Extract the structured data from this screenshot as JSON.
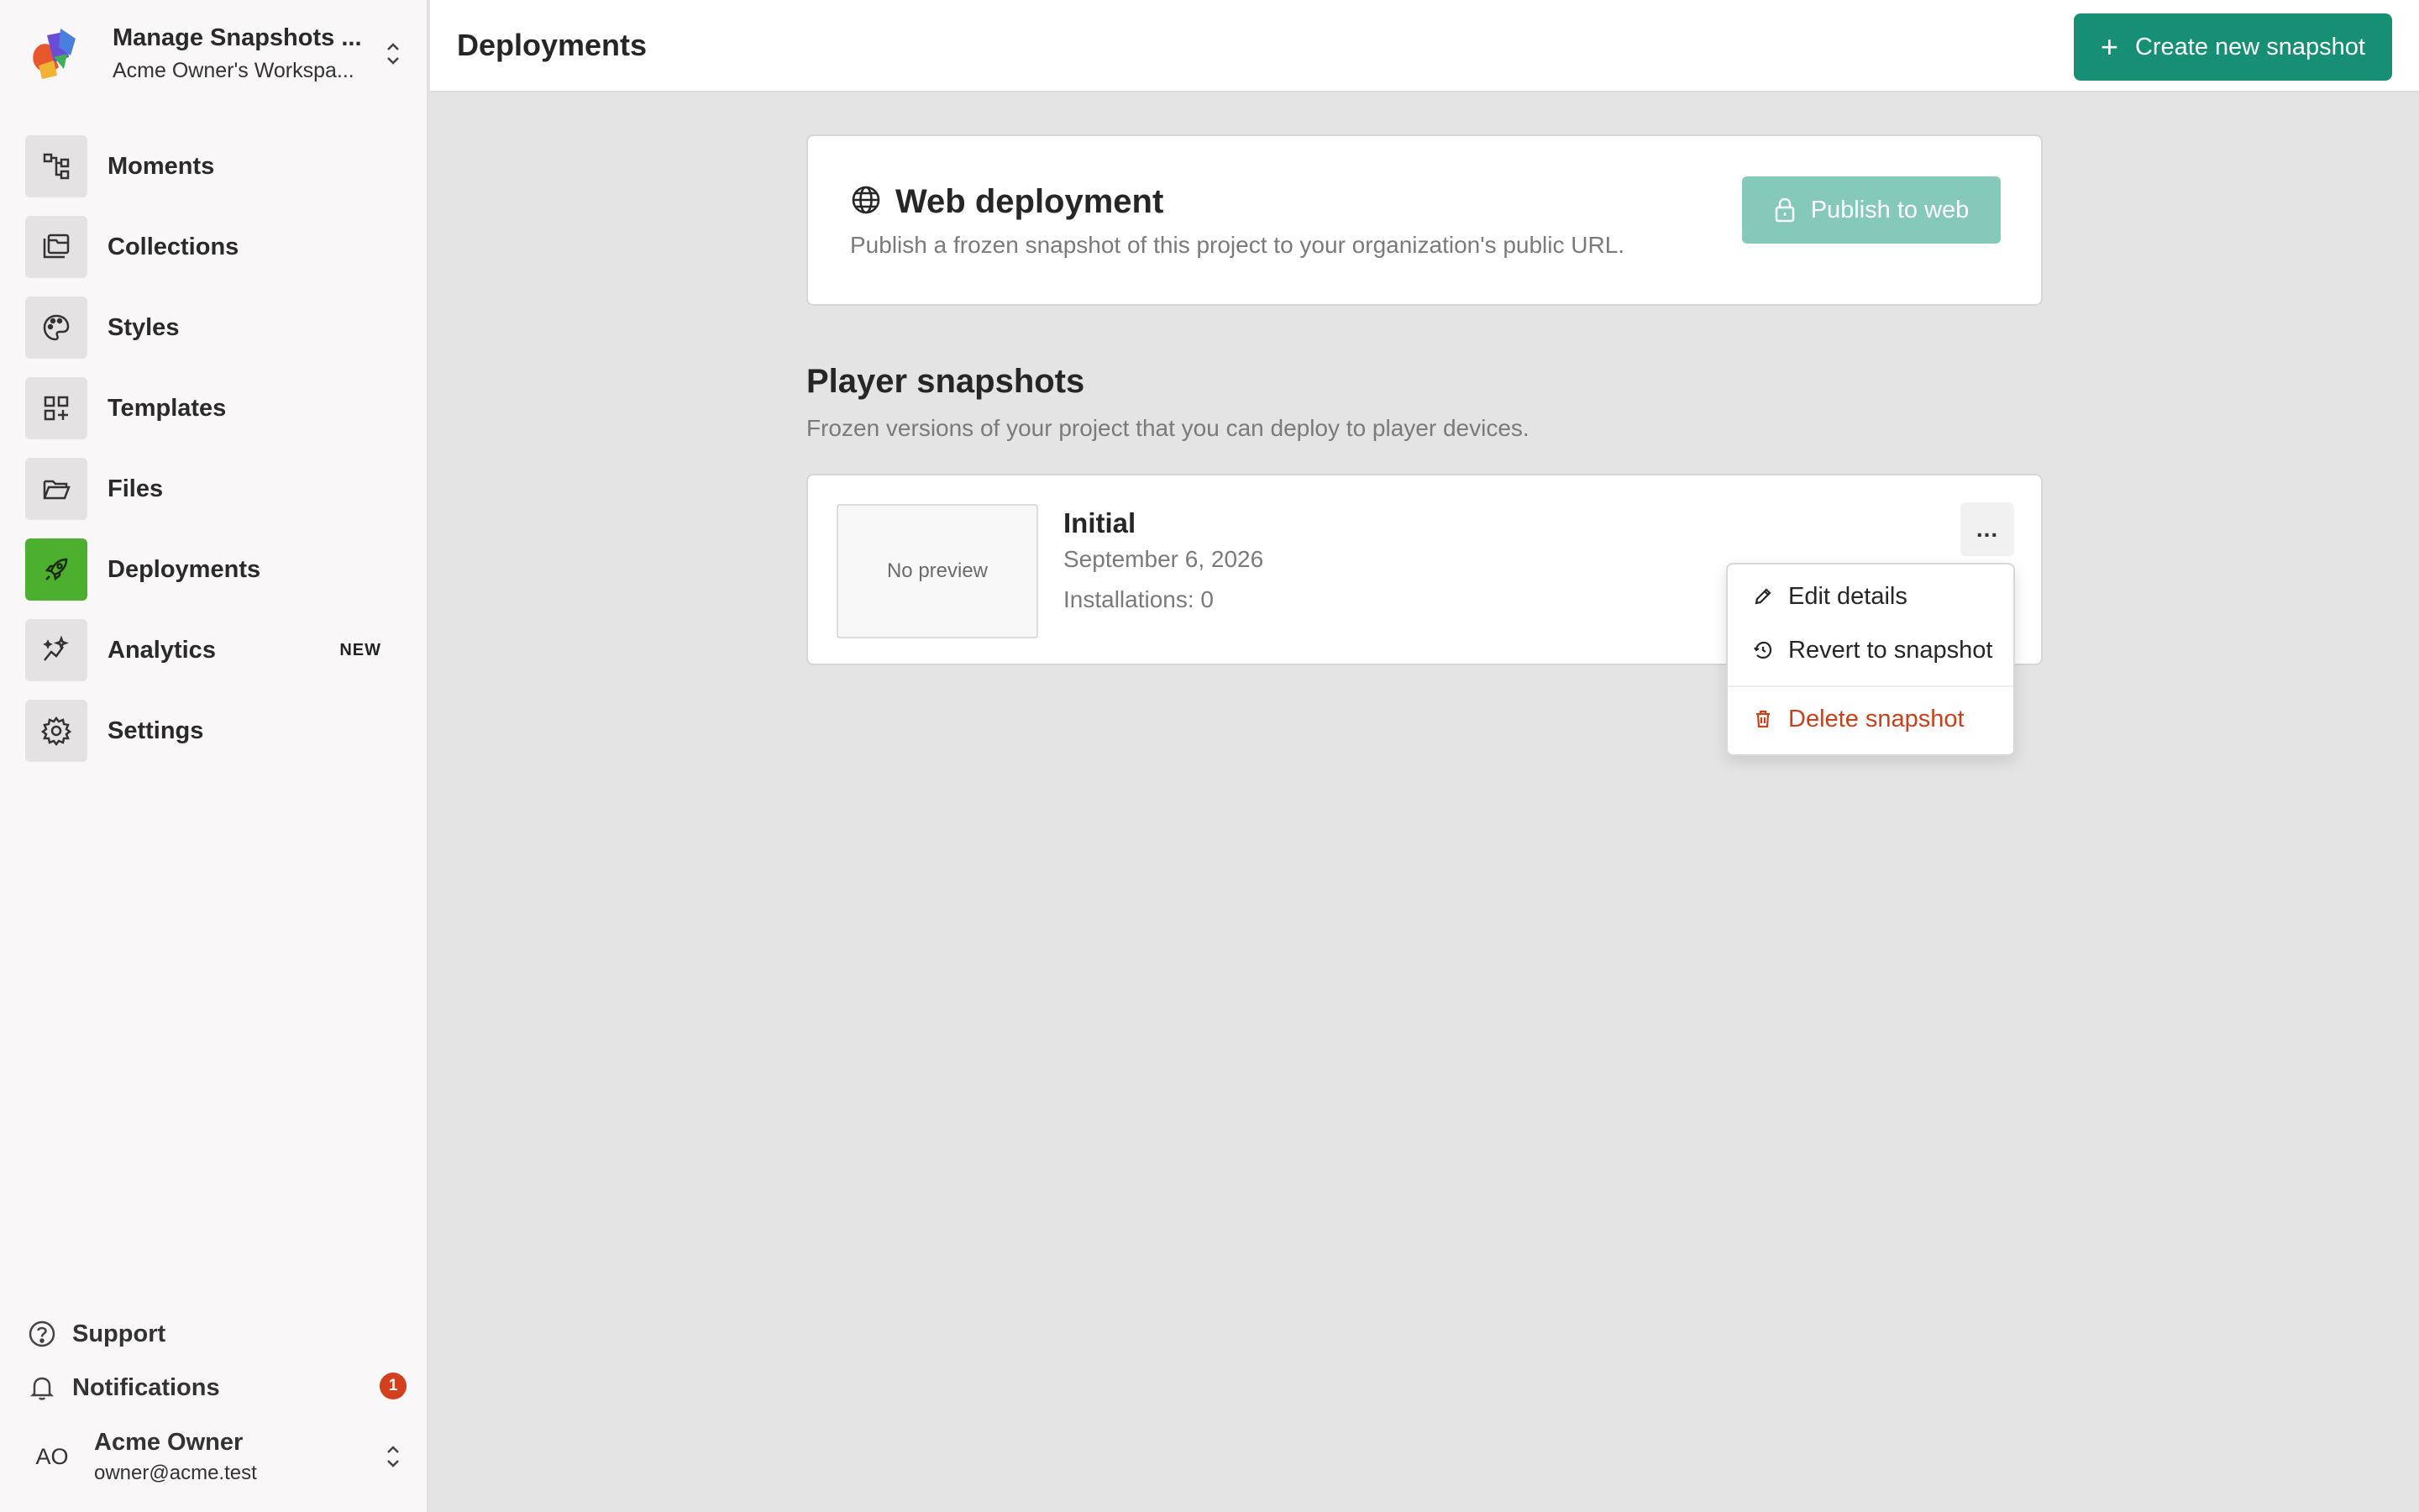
{
  "workspace": {
    "project_name": "Manage Snapshots ...",
    "workspace_name": "Acme Owner's Workspa..."
  },
  "sidebar": {
    "items": [
      {
        "label": "Moments",
        "icon": "moments-icon"
      },
      {
        "label": "Collections",
        "icon": "collections-icon"
      },
      {
        "label": "Styles",
        "icon": "palette-icon"
      },
      {
        "label": "Templates",
        "icon": "templates-icon"
      },
      {
        "label": "Files",
        "icon": "folder-icon"
      },
      {
        "label": "Deployments",
        "icon": "rocket-icon",
        "active": true
      },
      {
        "label": "Analytics",
        "icon": "analytics-icon",
        "badge": "NEW"
      },
      {
        "label": "Settings",
        "icon": "gear-icon"
      }
    ],
    "support_label": "Support",
    "notifications_label": "Notifications",
    "notifications_count": "1"
  },
  "user": {
    "initials": "AO",
    "name": "Acme Owner",
    "email": "owner@acme.test"
  },
  "header": {
    "title": "Deployments",
    "create_button": "Create new snapshot"
  },
  "web_deployment": {
    "title": "Web deployment",
    "description": "Publish a frozen snapshot of this project to your organization's public URL.",
    "publish_button": "Publish to web"
  },
  "player_snapshots": {
    "title": "Player snapshots",
    "description": "Frozen versions of your project that you can deploy to player devices.",
    "items": [
      {
        "preview_text": "No preview",
        "name": "Initial",
        "date": "September 6, 2026",
        "installations": "Installations: 0"
      }
    ]
  },
  "menu": {
    "more_label": "...",
    "edit": "Edit details",
    "revert": "Revert to snapshot",
    "delete": "Delete snapshot"
  },
  "colors": {
    "accent": "#178f74",
    "active_nav": "#4caf2e",
    "danger": "#c9401b",
    "publish_disabled": "#85c9bb"
  }
}
